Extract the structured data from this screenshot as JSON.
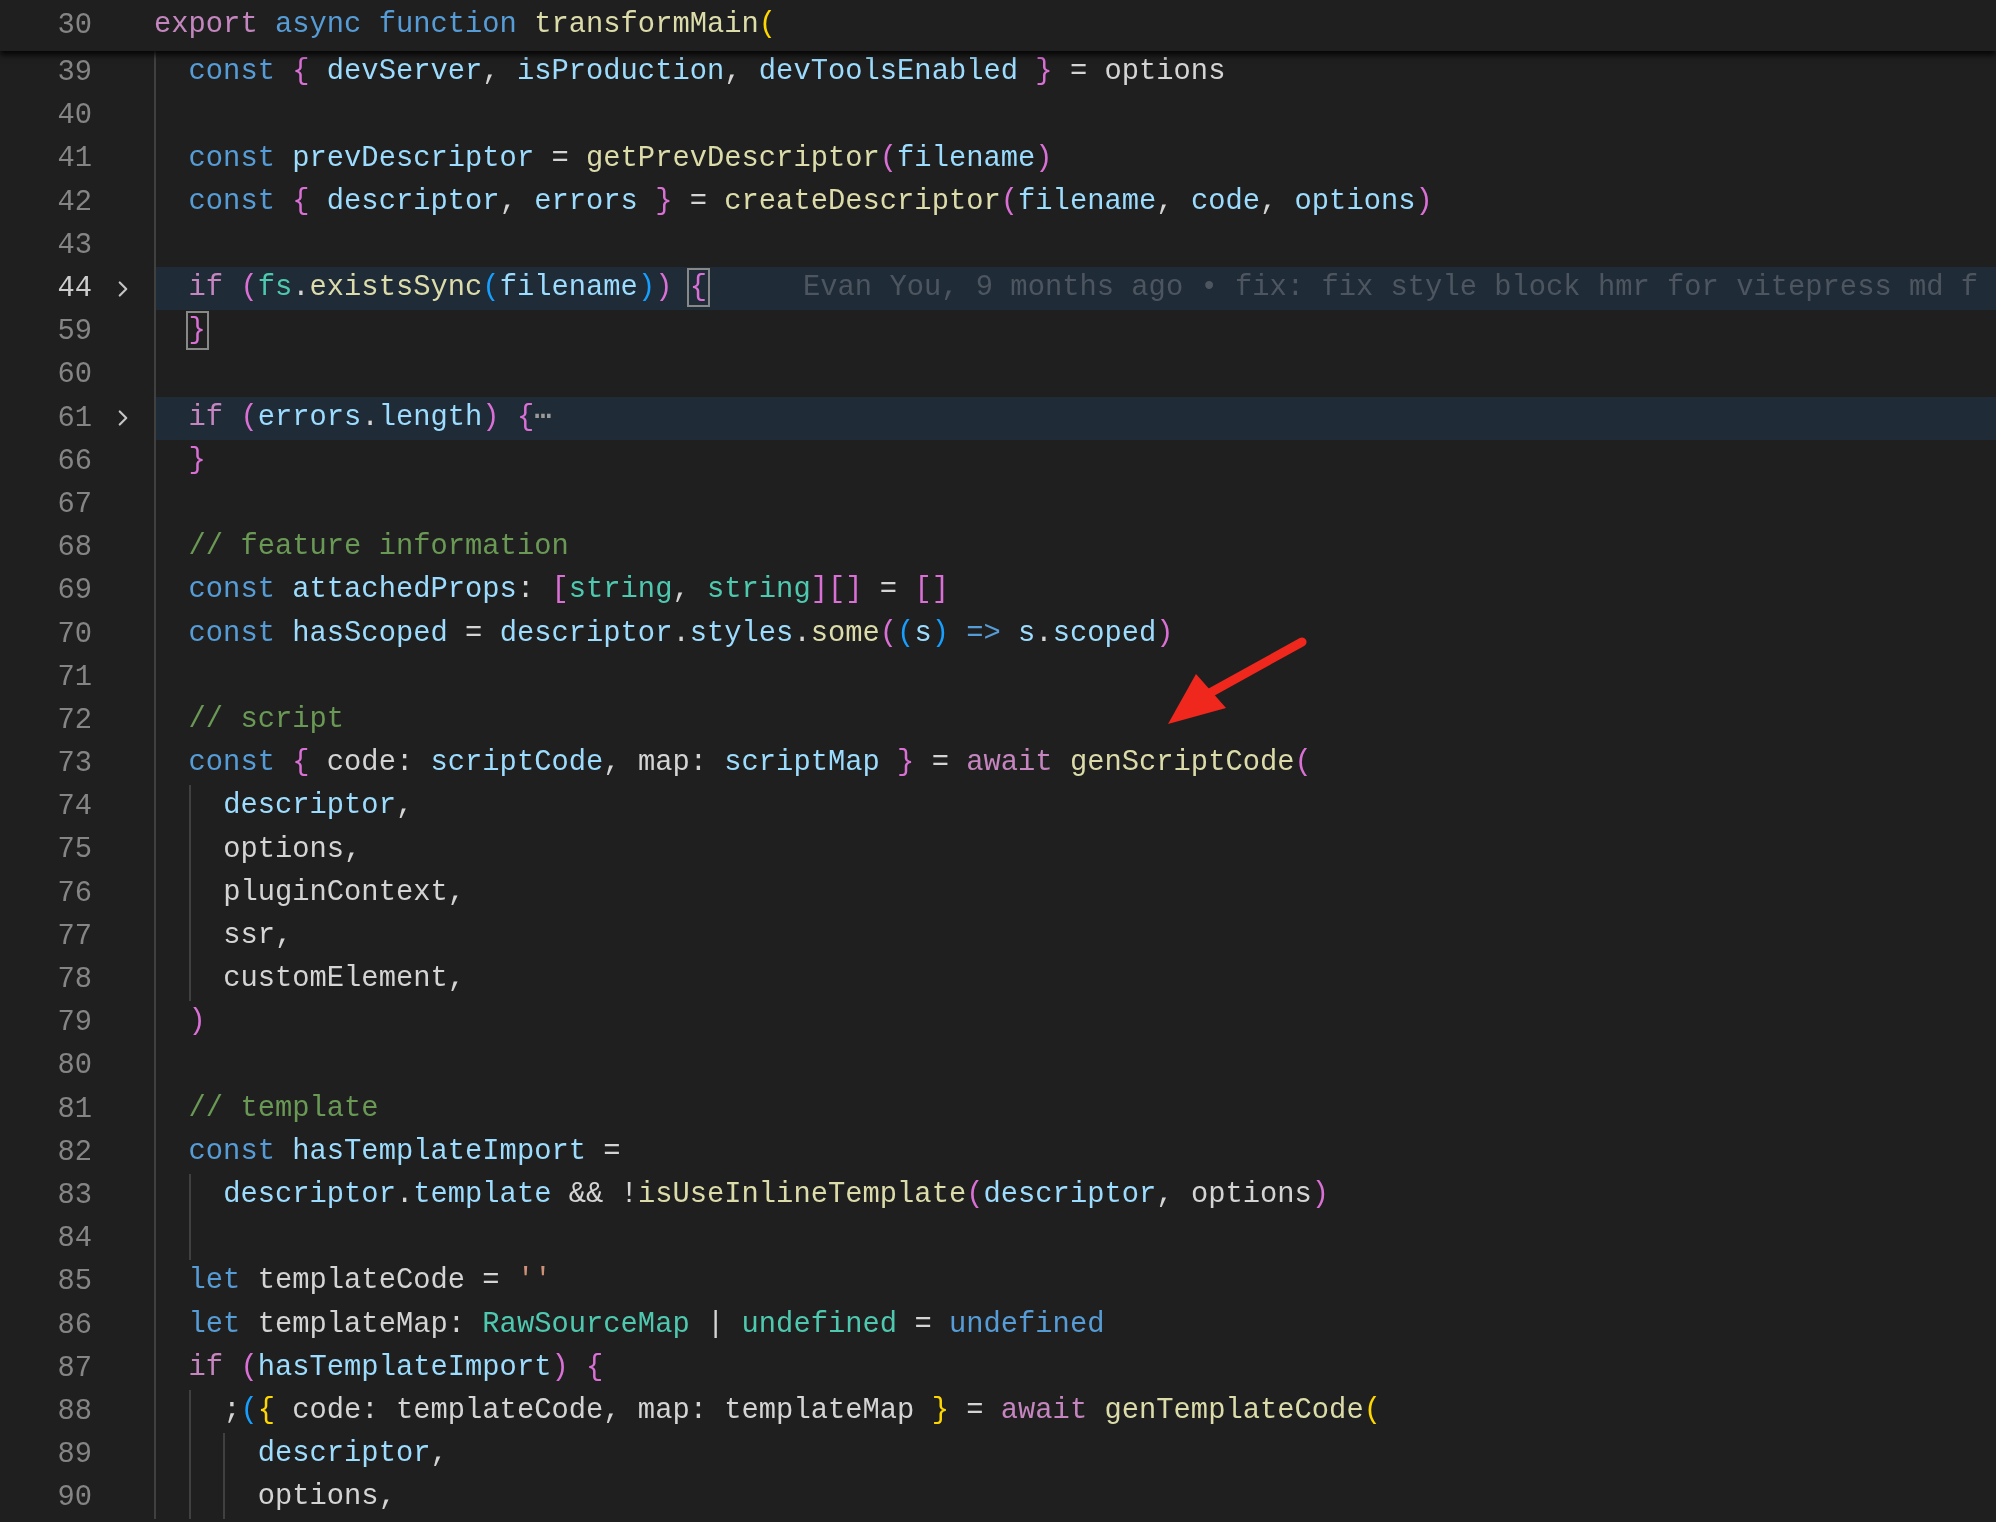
{
  "sticky_line": {
    "number": "30",
    "tokens": [
      {
        "text": "export ",
        "kind": "keyword"
      },
      {
        "text": "async ",
        "kind": "storage"
      },
      {
        "text": "function ",
        "kind": "storage"
      },
      {
        "text": "transformMain",
        "kind": "function"
      },
      {
        "text": "(",
        "kind": "bracket1"
      }
    ]
  },
  "lines": [
    {
      "number": "39",
      "current": false,
      "highlighted": false,
      "folded": false,
      "tokens": [
        {
          "text": "  const ",
          "kind": "storage"
        },
        {
          "text": "{ ",
          "kind": "bracket2"
        },
        {
          "text": "devServer",
          "kind": "variable"
        },
        {
          "text": ", ",
          "kind": "plain"
        },
        {
          "text": "isProduction",
          "kind": "variable"
        },
        {
          "text": ", ",
          "kind": "plain"
        },
        {
          "text": "devToolsEnabled ",
          "kind": "variable"
        },
        {
          "text": "} ",
          "kind": "bracket2"
        },
        {
          "text": "= ",
          "kind": "plain"
        },
        {
          "text": "options",
          "kind": "plain"
        }
      ]
    },
    {
      "number": "40",
      "current": false,
      "highlighted": false,
      "folded": false
    },
    {
      "number": "41",
      "current": false,
      "highlighted": false,
      "folded": false,
      "tokens": [
        {
          "text": "  const ",
          "kind": "storage"
        },
        {
          "text": "prevDescriptor ",
          "kind": "variable"
        },
        {
          "text": "= ",
          "kind": "plain"
        },
        {
          "text": "getPrevDescriptor",
          "kind": "function"
        },
        {
          "text": "(",
          "kind": "bracket2"
        },
        {
          "text": "filename",
          "kind": "variable"
        },
        {
          "text": ")",
          "kind": "bracket2"
        }
      ]
    },
    {
      "number": "42",
      "current": false,
      "highlighted": false,
      "folded": false,
      "tokens": [
        {
          "text": "  const ",
          "kind": "storage"
        },
        {
          "text": "{ ",
          "kind": "bracket2"
        },
        {
          "text": "descriptor",
          "kind": "variable"
        },
        {
          "text": ", ",
          "kind": "plain"
        },
        {
          "text": "errors ",
          "kind": "variable"
        },
        {
          "text": "} ",
          "kind": "bracket2"
        },
        {
          "text": "= ",
          "kind": "plain"
        },
        {
          "text": "createDescriptor",
          "kind": "function"
        },
        {
          "text": "(",
          "kind": "bracket2"
        },
        {
          "text": "filename",
          "kind": "variable"
        },
        {
          "text": ", ",
          "kind": "plain"
        },
        {
          "text": "code",
          "kind": "variable"
        },
        {
          "text": ", ",
          "kind": "plain"
        },
        {
          "text": "options",
          "kind": "variable"
        },
        {
          "text": ")",
          "kind": "bracket2"
        }
      ]
    },
    {
      "number": "43",
      "current": false,
      "highlighted": false,
      "folded": false
    },
    {
      "number": "44",
      "current": true,
      "highlighted": true,
      "folded": true,
      "blame": "Evan You, 9 months ago • fix: fix style block hmr for vitepress md f",
      "tokens": [
        {
          "text": "  if ",
          "kind": "keyword"
        },
        {
          "text": "(",
          "kind": "bracket2"
        },
        {
          "text": "fs",
          "kind": "type"
        },
        {
          "text": ".",
          "kind": "plain"
        },
        {
          "text": "existsSync",
          "kind": "function"
        },
        {
          "text": "(",
          "kind": "bracket3"
        },
        {
          "text": "filename",
          "kind": "variable"
        },
        {
          "text": ")",
          "kind": "bracket3"
        },
        {
          "text": ") ",
          "kind": "bracket2"
        },
        {
          "text": "{",
          "kind": "bracket2",
          "matched": true
        }
      ]
    },
    {
      "number": "59",
      "current": false,
      "highlighted": false,
      "folded": false,
      "tokens": [
        {
          "text": "  }",
          "kind": "bracket2",
          "matched": true
        }
      ]
    },
    {
      "number": "60",
      "current": false,
      "highlighted": false,
      "folded": false
    },
    {
      "number": "61",
      "current": false,
      "highlighted": true,
      "folded": true,
      "tokens": [
        {
          "text": "  if ",
          "kind": "keyword"
        },
        {
          "text": "(",
          "kind": "bracket2"
        },
        {
          "text": "errors",
          "kind": "variable"
        },
        {
          "text": ".",
          "kind": "plain"
        },
        {
          "text": "length",
          "kind": "variable"
        },
        {
          "text": ") ",
          "kind": "bracket2"
        },
        {
          "text": "{",
          "kind": "bracket2"
        },
        {
          "text": "⋯",
          "kind": "ellipsis"
        }
      ]
    },
    {
      "number": "66",
      "current": false,
      "highlighted": false,
      "folded": false,
      "tokens": [
        {
          "text": "  }",
          "kind": "bracket2"
        }
      ]
    },
    {
      "number": "67",
      "current": false,
      "highlighted": false,
      "folded": false
    },
    {
      "number": "68",
      "current": false,
      "highlighted": false,
      "folded": false,
      "tokens": [
        {
          "text": "  // feature information",
          "kind": "comment"
        }
      ]
    },
    {
      "number": "69",
      "current": false,
      "highlighted": false,
      "folded": false,
      "tokens": [
        {
          "text": "  const ",
          "kind": "storage"
        },
        {
          "text": "attachedProps",
          "kind": "variable"
        },
        {
          "text": ": ",
          "kind": "plain"
        },
        {
          "text": "[",
          "kind": "bracket2"
        },
        {
          "text": "string",
          "kind": "type"
        },
        {
          "text": ", ",
          "kind": "plain"
        },
        {
          "text": "string",
          "kind": "type"
        },
        {
          "text": "][] ",
          "kind": "bracket2"
        },
        {
          "text": "= ",
          "kind": "plain"
        },
        {
          "text": "[]",
          "kind": "bracket2"
        }
      ]
    },
    {
      "number": "70",
      "current": false,
      "highlighted": false,
      "folded": false,
      "tokens": [
        {
          "text": "  const ",
          "kind": "storage"
        },
        {
          "text": "hasScoped ",
          "kind": "variable"
        },
        {
          "text": "= ",
          "kind": "plain"
        },
        {
          "text": "descriptor",
          "kind": "variable"
        },
        {
          "text": ".",
          "kind": "plain"
        },
        {
          "text": "styles",
          "kind": "variable"
        },
        {
          "text": ".",
          "kind": "plain"
        },
        {
          "text": "some",
          "kind": "function"
        },
        {
          "text": "(",
          "kind": "bracket2"
        },
        {
          "text": "(",
          "kind": "bracket3"
        },
        {
          "text": "s",
          "kind": "variable"
        },
        {
          "text": ") ",
          "kind": "bracket3"
        },
        {
          "text": "=> ",
          "kind": "storage"
        },
        {
          "text": "s",
          "kind": "variable"
        },
        {
          "text": ".",
          "kind": "plain"
        },
        {
          "text": "scoped",
          "kind": "variable"
        },
        {
          "text": ")",
          "kind": "bracket2"
        }
      ]
    },
    {
      "number": "71",
      "current": false,
      "highlighted": false,
      "folded": false
    },
    {
      "number": "72",
      "current": false,
      "highlighted": false,
      "folded": false,
      "tokens": [
        {
          "text": "  // script",
          "kind": "comment"
        }
      ]
    },
    {
      "number": "73",
      "current": false,
      "highlighted": false,
      "folded": false,
      "tokens": [
        {
          "text": "  const ",
          "kind": "storage"
        },
        {
          "text": "{ ",
          "kind": "bracket2"
        },
        {
          "text": "code",
          "kind": "plain"
        },
        {
          "text": ": ",
          "kind": "plain"
        },
        {
          "text": "scriptCode",
          "kind": "variable"
        },
        {
          "text": ", ",
          "kind": "plain"
        },
        {
          "text": "map",
          "kind": "plain"
        },
        {
          "text": ": ",
          "kind": "plain"
        },
        {
          "text": "scriptMap ",
          "kind": "variable"
        },
        {
          "text": "} ",
          "kind": "bracket2"
        },
        {
          "text": "= ",
          "kind": "plain"
        },
        {
          "text": "await ",
          "kind": "keyword"
        },
        {
          "text": "genScriptCode",
          "kind": "function"
        },
        {
          "text": "(",
          "kind": "bracket2"
        }
      ]
    },
    {
      "number": "74",
      "current": false,
      "highlighted": false,
      "folded": false,
      "tokens": [
        {
          "text": "    descriptor",
          "kind": "variable"
        },
        {
          "text": ",",
          "kind": "plain"
        }
      ]
    },
    {
      "number": "75",
      "current": false,
      "highlighted": false,
      "folded": false,
      "tokens": [
        {
          "text": "    options,",
          "kind": "plain"
        }
      ]
    },
    {
      "number": "76",
      "current": false,
      "highlighted": false,
      "folded": false,
      "tokens": [
        {
          "text": "    pluginContext,",
          "kind": "plain"
        }
      ]
    },
    {
      "number": "77",
      "current": false,
      "highlighted": false,
      "folded": false,
      "tokens": [
        {
          "text": "    ssr,",
          "kind": "plain"
        }
      ]
    },
    {
      "number": "78",
      "current": false,
      "highlighted": false,
      "folded": false,
      "tokens": [
        {
          "text": "    customElement,",
          "kind": "plain"
        }
      ]
    },
    {
      "number": "79",
      "current": false,
      "highlighted": false,
      "folded": false,
      "tokens": [
        {
          "text": "  )",
          "kind": "bracket2"
        }
      ]
    },
    {
      "number": "80",
      "current": false,
      "highlighted": false,
      "folded": false
    },
    {
      "number": "81",
      "current": false,
      "highlighted": false,
      "folded": false,
      "tokens": [
        {
          "text": "  // template",
          "kind": "comment"
        }
      ]
    },
    {
      "number": "82",
      "current": false,
      "highlighted": false,
      "folded": false,
      "tokens": [
        {
          "text": "  const ",
          "kind": "storage"
        },
        {
          "text": "hasTemplateImport ",
          "kind": "variable"
        },
        {
          "text": "=",
          "kind": "plain"
        }
      ]
    },
    {
      "number": "83",
      "current": false,
      "highlighted": false,
      "folded": false,
      "tokens": [
        {
          "text": "    descriptor",
          "kind": "variable"
        },
        {
          "text": ".",
          "kind": "plain"
        },
        {
          "text": "template ",
          "kind": "variable"
        },
        {
          "text": "&& !",
          "kind": "plain"
        },
        {
          "text": "isUseInlineTemplate",
          "kind": "function"
        },
        {
          "text": "(",
          "kind": "bracket2"
        },
        {
          "text": "descriptor",
          "kind": "variable"
        },
        {
          "text": ", ",
          "kind": "plain"
        },
        {
          "text": "options",
          "kind": "plain"
        },
        {
          "text": ")",
          "kind": "bracket2"
        }
      ]
    },
    {
      "number": "84",
      "current": false,
      "highlighted": false,
      "folded": false
    },
    {
      "number": "85",
      "current": false,
      "highlighted": false,
      "folded": false,
      "tokens": [
        {
          "text": "  let ",
          "kind": "storage"
        },
        {
          "text": "templateCode ",
          "kind": "plain"
        },
        {
          "text": "= ",
          "kind": "plain"
        },
        {
          "text": "''",
          "kind": "string"
        }
      ]
    },
    {
      "number": "86",
      "current": false,
      "highlighted": false,
      "folded": false,
      "tokens": [
        {
          "text": "  let ",
          "kind": "storage"
        },
        {
          "text": "templateMap",
          "kind": "plain"
        },
        {
          "text": ": ",
          "kind": "plain"
        },
        {
          "text": "RawSourceMap ",
          "kind": "type"
        },
        {
          "text": "| ",
          "kind": "plain"
        },
        {
          "text": "undefined ",
          "kind": "type"
        },
        {
          "text": "= ",
          "kind": "plain"
        },
        {
          "text": "undefined",
          "kind": "storage"
        }
      ]
    },
    {
      "number": "87",
      "current": false,
      "highlighted": false,
      "folded": false,
      "tokens": [
        {
          "text": "  if ",
          "kind": "keyword"
        },
        {
          "text": "(",
          "kind": "bracket2"
        },
        {
          "text": "hasTemplateImport",
          "kind": "variable"
        },
        {
          "text": ") ",
          "kind": "bracket2"
        },
        {
          "text": "{",
          "kind": "bracket2"
        }
      ]
    },
    {
      "number": "88",
      "current": false,
      "highlighted": false,
      "folded": false,
      "tokens": [
        {
          "text": "    ;",
          "kind": "plain"
        },
        {
          "text": "(",
          "kind": "bracket3"
        },
        {
          "text": "{ ",
          "kind": "bracket1"
        },
        {
          "text": "code: templateCode, map: templateMap ",
          "kind": "plain"
        },
        {
          "text": "} ",
          "kind": "bracket1"
        },
        {
          "text": "= ",
          "kind": "plain"
        },
        {
          "text": "await ",
          "kind": "keyword"
        },
        {
          "text": "genTemplateCode",
          "kind": "function"
        },
        {
          "text": "(",
          "kind": "bracket1"
        }
      ]
    },
    {
      "number": "89",
      "current": false,
      "highlighted": false,
      "folded": false,
      "tokens": [
        {
          "text": "      descriptor",
          "kind": "variable"
        },
        {
          "text": ",",
          "kind": "plain"
        }
      ]
    },
    {
      "number": "90",
      "current": false,
      "highlighted": false,
      "folded": false,
      "tokens": [
        {
          "text": "      options,",
          "kind": "plain"
        }
      ]
    }
  ]
}
